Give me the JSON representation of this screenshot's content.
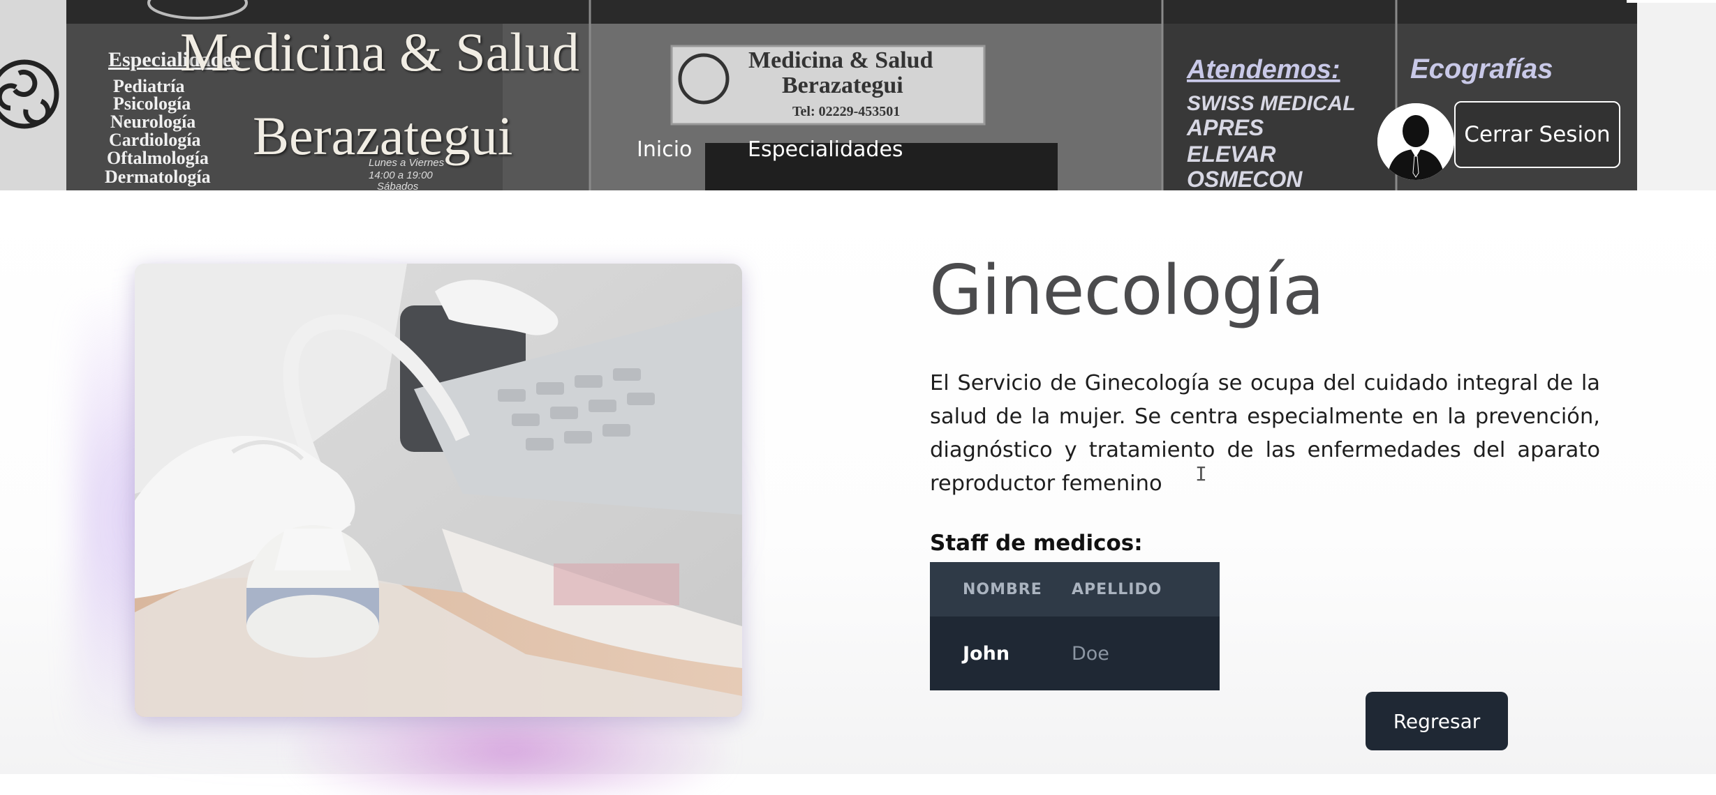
{
  "header": {
    "brand_line1": "Medicina & Salud",
    "brand_line2": "Berazategui",
    "nav": [
      {
        "label": "Inicio"
      },
      {
        "label": "Especialidades"
      }
    ],
    "logout_label": "Cerrar Sesion",
    "storefront_sign": {
      "specialties_heading": "Especialidades",
      "specialties": [
        "Pediatría",
        "Psicología",
        "Neurología",
        "Cardiología",
        "Oftalmología",
        "Dermatología"
      ],
      "hours": [
        "Lunes a Viernes",
        "14:00 a 19:00",
        "Sábados"
      ],
      "sign_title_1": "Medicina & Salud",
      "sign_title_2": "Berazategui",
      "sign_phone": "Tel: 02229-453501",
      "attend_heading": "Atendemos:",
      "insurers": [
        "SWISS MEDICAL",
        "APRES",
        "ELEVAR",
        "OSMECON"
      ],
      "echo_heading": "Ecografías"
    }
  },
  "main": {
    "title": "Ginecología",
    "description": "El Servicio de Ginecología se ocupa del cuidado integral de la salud de la mujer. Se centra especialmente en la prevención, diagnóstico y tratamiento de las enfermedades del aparato reproductor femenino",
    "staff_label": "Staff de medicos:",
    "staff_table": {
      "headers": [
        "NOMBRE",
        "APELLIDO"
      ],
      "rows": [
        {
          "nombre": "John",
          "apellido": "Doe"
        }
      ]
    },
    "back_label": "Regresar"
  },
  "colors": {
    "header_bg": "#3d3d3d",
    "table_bg": "#1f2834",
    "table_header_bg": "#2f3a47",
    "button_bg": "#1f2834",
    "title_color": "#4b4b4d",
    "glow": "#b596ec"
  },
  "icons": {
    "logo": "triskelion-logo-icon",
    "avatar": "user-avatar-icon",
    "photo": "ultrasound-photo"
  }
}
